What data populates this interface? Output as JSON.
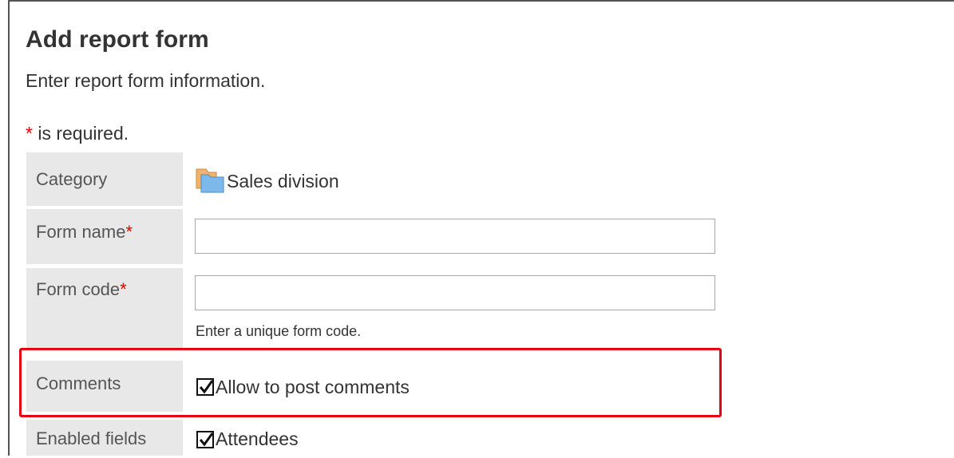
{
  "header": {
    "title": "Add report form",
    "subtitle": "Enter report form information."
  },
  "required_note": {
    "star": "*",
    "text": " is required."
  },
  "form": {
    "category": {
      "label": "Category",
      "value": "Sales division",
      "icon": "folder-icon"
    },
    "form_name": {
      "label": "Form name",
      "required_star": "*",
      "value": ""
    },
    "form_code": {
      "label": "Form code",
      "required_star": "*",
      "value": "",
      "hint": "Enter a unique form code."
    },
    "comments": {
      "label": "Comments",
      "checkbox_label": "Allow to post comments",
      "checked": true
    },
    "enabled_fields": {
      "label": "Enabled fields",
      "checkbox_label": "Attendees",
      "checked": true
    }
  },
  "colors": {
    "required_star": "#e60000",
    "highlight_border": "#e60012",
    "label_background": "#e8e8e8"
  }
}
